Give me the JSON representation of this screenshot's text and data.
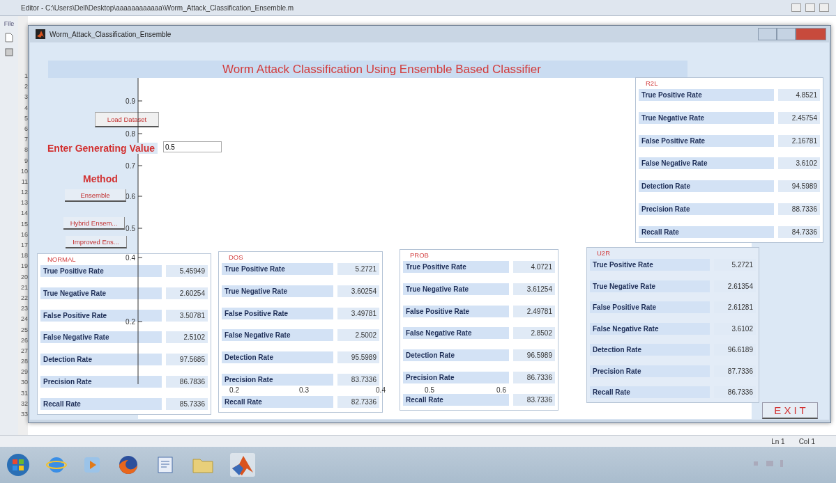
{
  "editor": {
    "title": "Editor - C:\\Users\\Dell\\Desktop\\aaaaaaaaaaaa\\Worm_Attack_Classification_Ensemble.m",
    "menu": "File",
    "line_numbers": [
      "1",
      "2",
      "3",
      "4",
      "5",
      "6",
      "7",
      "8",
      "9",
      "10",
      "11",
      "12",
      "13",
      "14",
      "15",
      "16",
      "17",
      "18",
      "19",
      "20",
      "21",
      "22",
      "23",
      "24",
      "25",
      "26",
      "27",
      "28",
      "29",
      "30",
      "31",
      "32",
      "33"
    ],
    "status": {
      "line": "Ln 1",
      "column": "Col 1"
    }
  },
  "figure": {
    "title": "Worm_Attack_Classification_Ensemble",
    "heading": "Worm Attack Classification Using Ensemble Based Classifier",
    "load_button": "Load Dataset",
    "generating": {
      "label": "Enter Generating Value",
      "value": "0.5"
    },
    "method_label": "Method",
    "method_buttons": [
      "Ensemble",
      "Hybrid Ensem...",
      "Improved Ens..."
    ],
    "axes": {
      "y_ticks": [
        "0.9",
        "0.8",
        "0.7",
        "0.6",
        "0.5",
        "0.4",
        "0.2"
      ],
      "x_ticks": [
        "0.2",
        "0.3",
        "0.4",
        "0.5",
        "0.6"
      ]
    },
    "panels": [
      {
        "title": "R2L",
        "rows": [
          {
            "label": "True Positive Rate",
            "value": "4.8521"
          },
          {
            "label": "True Negative Rate",
            "value": "2.45754"
          },
          {
            "label": "False Positive Rate",
            "value": "2.16781"
          },
          {
            "label": "False Negative Rate",
            "value": "3.6102"
          },
          {
            "label": "Detection Rate",
            "value": "94.5989"
          },
          {
            "label": "Precision Rate",
            "value": "88.7336"
          },
          {
            "label": "Recall Rate",
            "value": "84.7336"
          }
        ]
      },
      {
        "title": "NORMAL",
        "rows": [
          {
            "label": "True Positive Rate",
            "value": "5.45949"
          },
          {
            "label": "True Negative Rate",
            "value": "2.60254"
          },
          {
            "label": "False Positive Rate",
            "value": "3.50781"
          },
          {
            "label": "False Negative Rate",
            "value": "2.5102"
          },
          {
            "label": "Detection Rate",
            "value": "97.5685"
          },
          {
            "label": "Precision Rate",
            "value": "86.7836"
          },
          {
            "label": "Recall Rate",
            "value": "85.7336"
          }
        ]
      },
      {
        "title": "DOS",
        "rows": [
          {
            "label": "True Positive Rate",
            "value": "5.2721"
          },
          {
            "label": "True Negative Rate",
            "value": "3.60254"
          },
          {
            "label": "False Positive Rate",
            "value": "3.49781"
          },
          {
            "label": "False Negative Rate",
            "value": "2.5002"
          },
          {
            "label": "Detection Rate",
            "value": "95.5989"
          },
          {
            "label": "Precision Rate",
            "value": "83.7336"
          },
          {
            "label": "Recall Rate",
            "value": "82.7336"
          }
        ]
      },
      {
        "title": "PROB",
        "rows": [
          {
            "label": "True Positive Rate",
            "value": "4.0721"
          },
          {
            "label": "True Negative Rate",
            "value": "3.61254"
          },
          {
            "label": "False Positive Rate",
            "value": "2.49781"
          },
          {
            "label": "False Negative Rate",
            "value": "2.8502"
          },
          {
            "label": "Detection Rate",
            "value": "96.5989"
          },
          {
            "label": "Precision Rate",
            "value": "86.7336"
          },
          {
            "label": "Recall Rate",
            "value": "83.7336"
          }
        ]
      },
      {
        "title": "U2R",
        "rows": [
          {
            "label": "True Positive Rate",
            "value": "5.2721"
          },
          {
            "label": "True Negative Rate",
            "value": "2.61354"
          },
          {
            "label": "False Positive Rate",
            "value": "2.61281"
          },
          {
            "label": "False Negative Rate",
            "value": "3.6102"
          },
          {
            "label": "Detection Rate",
            "value": "96.6189"
          },
          {
            "label": "Precision Rate",
            "value": "87.7336"
          },
          {
            "label": "Recall Rate",
            "value": "86.7336"
          }
        ]
      }
    ],
    "exit_button": "E X I T"
  }
}
